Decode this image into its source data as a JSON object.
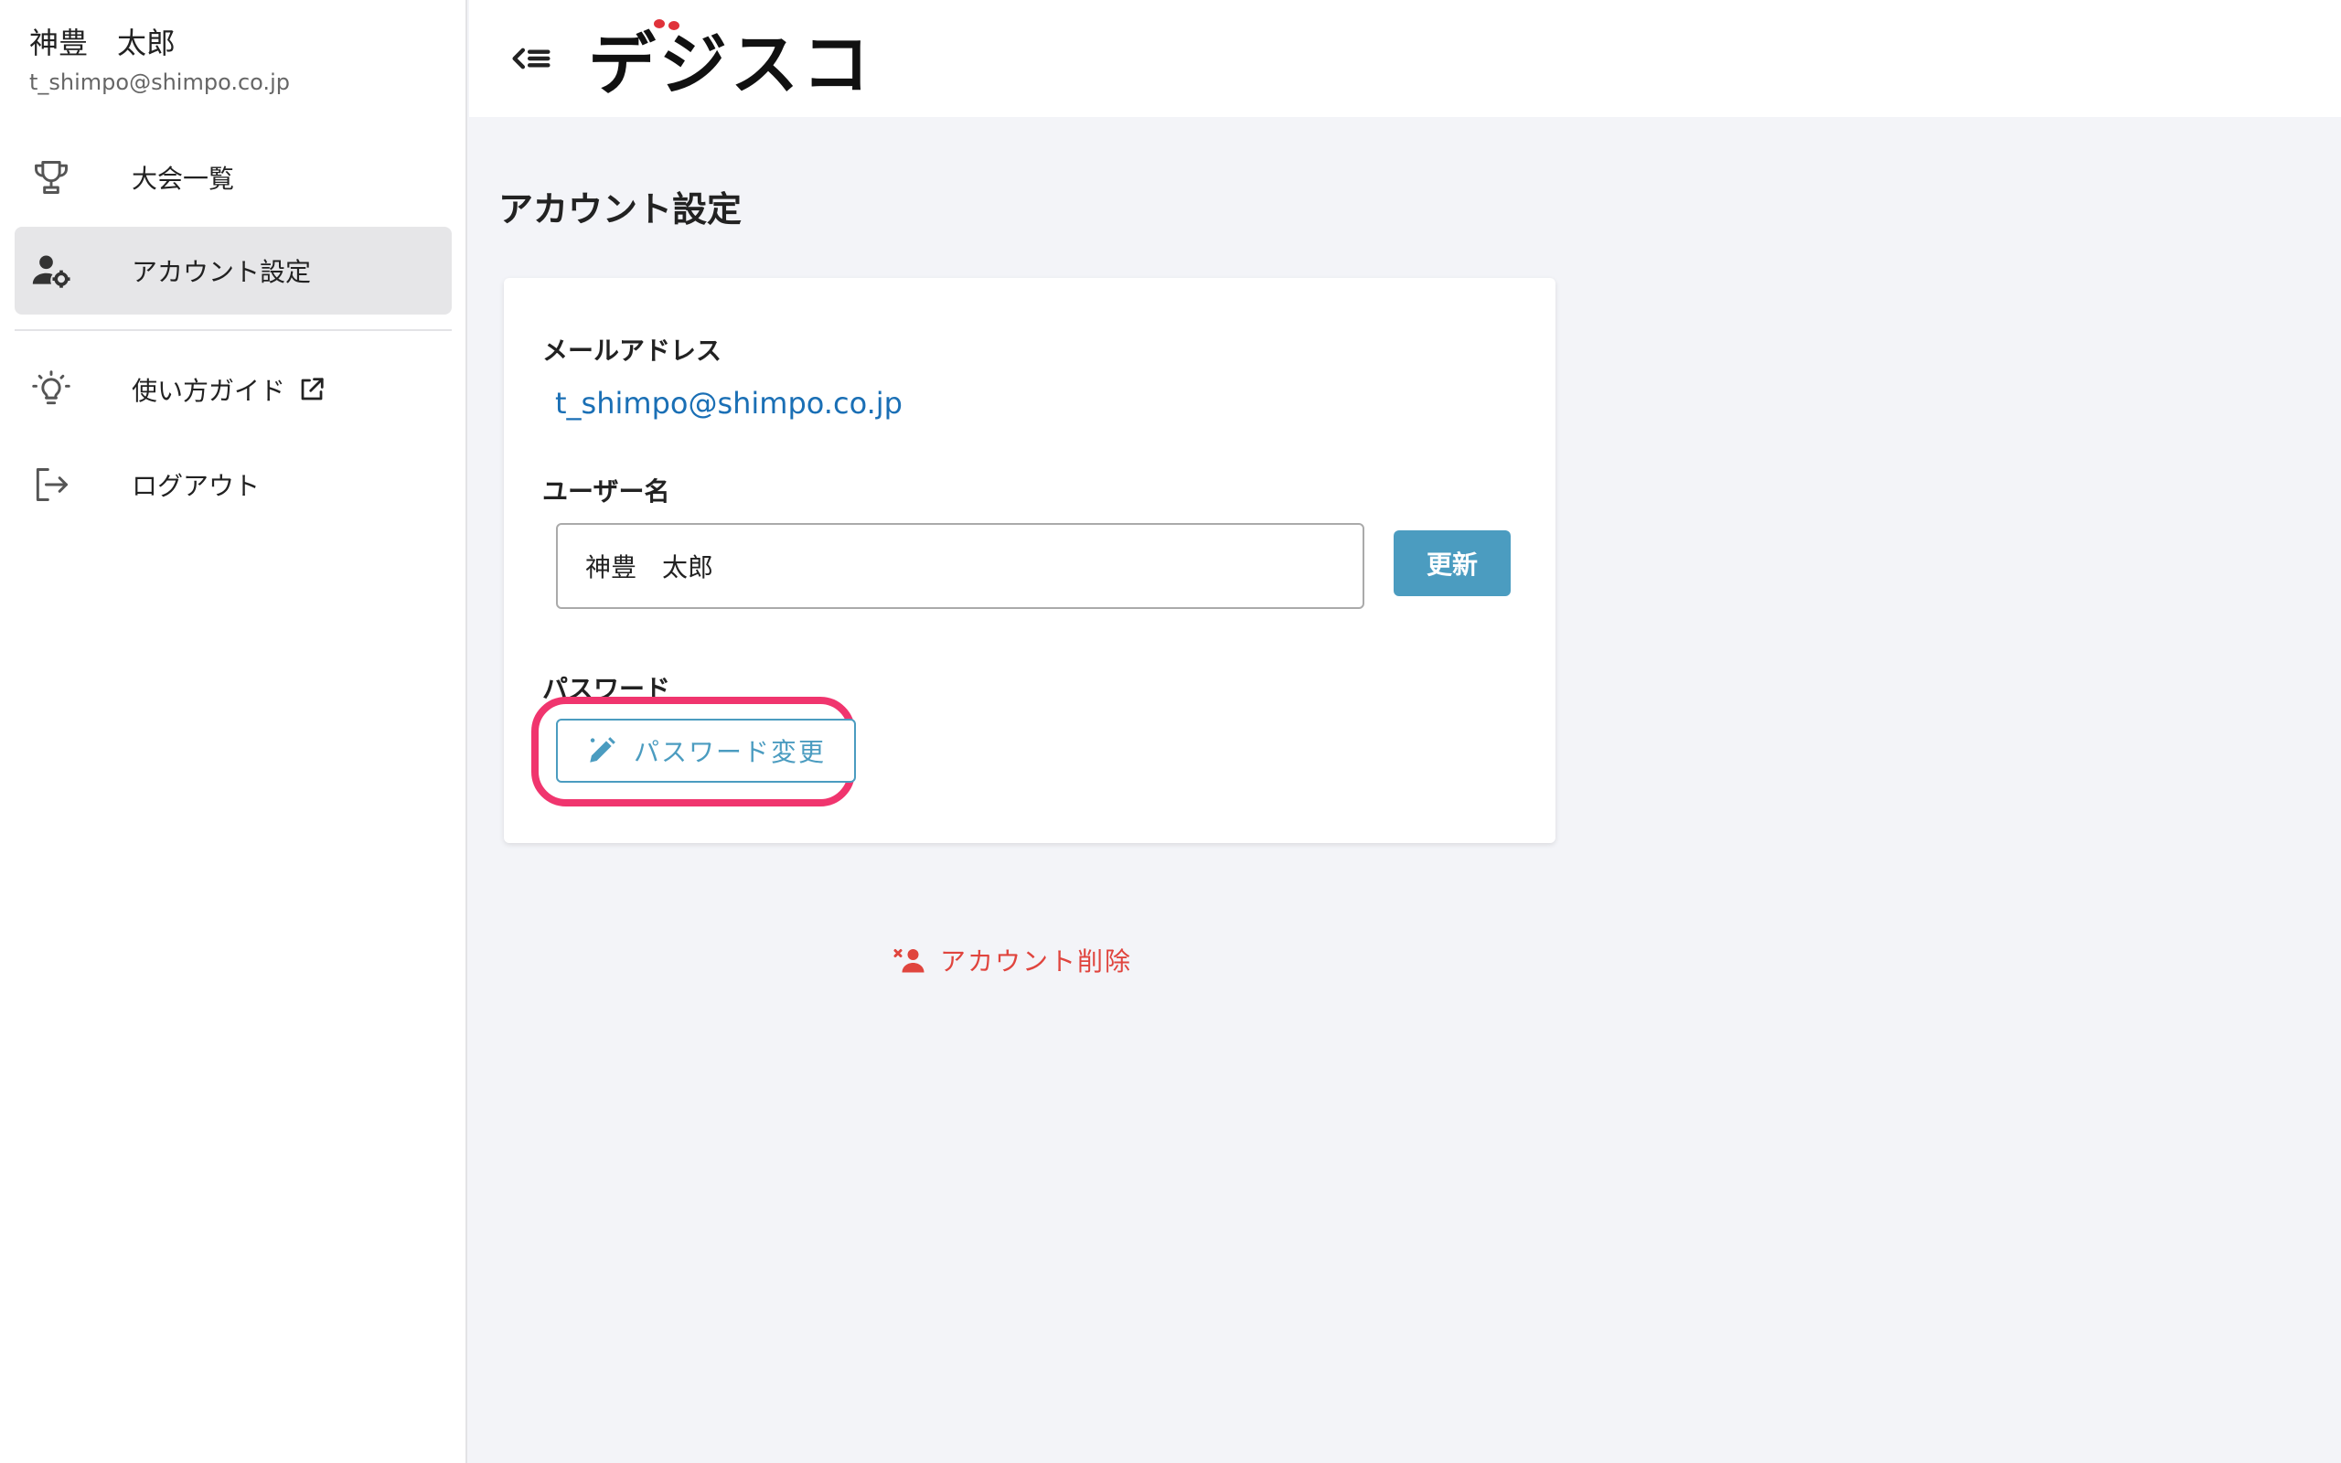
{
  "sidebar": {
    "user_name": "神豊　太郎",
    "user_email": "t_shimpo@shimpo.co.jp",
    "items": [
      {
        "label": "大会一覧",
        "icon": "trophy-icon"
      },
      {
        "label": "アカウント設定",
        "icon": "user-gear-icon",
        "active": true
      },
      {
        "label": "使い方ガイド",
        "icon": "lightbulb-icon",
        "external": true
      },
      {
        "label": "ログアウト",
        "icon": "logout-icon"
      }
    ]
  },
  "header": {
    "logo_text": "デジスコ",
    "back_icon": "collapse-menu-icon"
  },
  "main": {
    "page_title": "アカウント設定",
    "email_label": "メールアドレス",
    "email_value": "t_shimpo@shimpo.co.jp",
    "username_label": "ユーザー名",
    "username_value": "神豊　太郎",
    "update_label": "更新",
    "password_label": "パスワード",
    "password_change_label": "パスワード変更",
    "delete_account_label": "アカウント削除"
  },
  "colors": {
    "accent": "#4b9cc0",
    "link": "#1a6fb5",
    "danger": "#e0453e",
    "highlight": "#f0356e",
    "active_nav": "#e6e6e8"
  }
}
